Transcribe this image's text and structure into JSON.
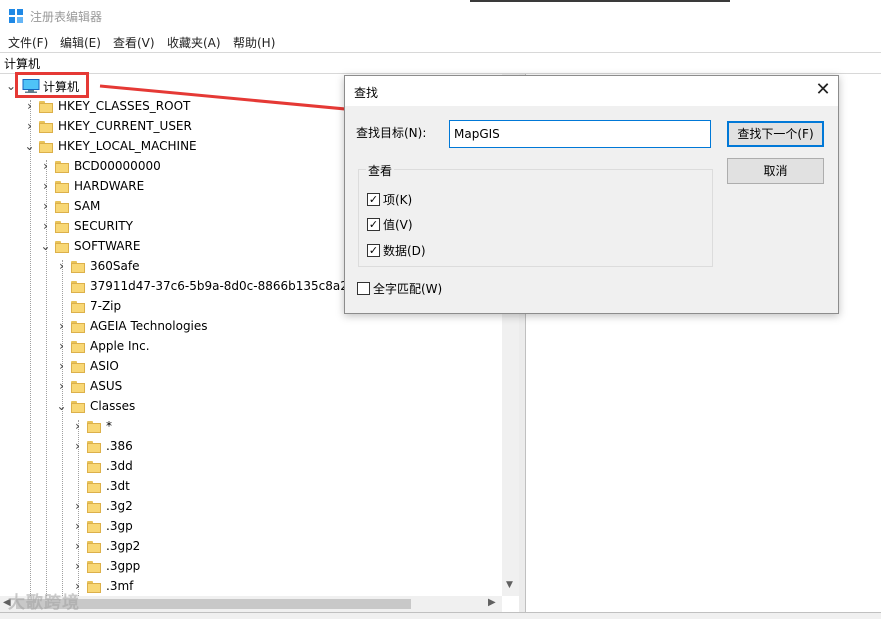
{
  "window": {
    "title": "注册表编辑器"
  },
  "menu": [
    "文件(F)",
    "编辑(E)",
    "查看(V)",
    "收藏夹(A)",
    "帮助(H)"
  ],
  "address": "计算机",
  "tree": {
    "root": "计算机",
    "rows": [
      {
        "label": "HKEY_CLASSES_ROOT",
        "expander": "›"
      },
      {
        "label": "HKEY_CURRENT_USER",
        "expander": "›"
      },
      {
        "label": "HKEY_LOCAL_MACHINE",
        "expander": "⌄"
      },
      {
        "label": "BCD00000000",
        "expander": "›"
      },
      {
        "label": "HARDWARE",
        "expander": "›"
      },
      {
        "label": "SAM",
        "expander": "›"
      },
      {
        "label": "SECURITY",
        "expander": "›"
      },
      {
        "label": "SOFTWARE",
        "expander": "⌄"
      },
      {
        "label": "360Safe",
        "expander": "›"
      },
      {
        "label": "37911d47-37c6-5b9a-8d0c-8866b135c8a2",
        "expander": ""
      },
      {
        "label": "7-Zip",
        "expander": ""
      },
      {
        "label": "AGEIA Technologies",
        "expander": "›"
      },
      {
        "label": "Apple Inc.",
        "expander": "›"
      },
      {
        "label": "ASIO",
        "expander": "›"
      },
      {
        "label": "ASUS",
        "expander": "›"
      },
      {
        "label": "Classes",
        "expander": "⌄"
      },
      {
        "label": "*",
        "expander": "›"
      },
      {
        "label": ".386",
        "expander": "›"
      },
      {
        "label": ".3dd",
        "expander": ""
      },
      {
        "label": ".3dt",
        "expander": ""
      },
      {
        "label": ".3g2",
        "expander": "›"
      },
      {
        "label": ".3gp",
        "expander": "›"
      },
      {
        "label": ".3gp2",
        "expander": "›"
      },
      {
        "label": ".3gpp",
        "expander": "›"
      },
      {
        "label": ".3mf",
        "expander": "›"
      }
    ]
  },
  "find_dialog": {
    "title": "查找",
    "find_what_label": "查找目标(N):",
    "find_what_value": "MapGIS",
    "find_next_button": "查找下一个(F)",
    "cancel_button": "取消",
    "look_at_label": "查看",
    "options": [
      {
        "label": "项(K)",
        "checked": true
      },
      {
        "label": "值(V)",
        "checked": true
      },
      {
        "label": "数据(D)",
        "checked": true
      }
    ],
    "match_whole": {
      "label": "全字匹配(W)",
      "checked": false
    }
  },
  "watermark": "大歌跨境",
  "colors": {
    "highlight": "#e53935",
    "accent": "#0078d7",
    "folder": "#f8d775"
  }
}
